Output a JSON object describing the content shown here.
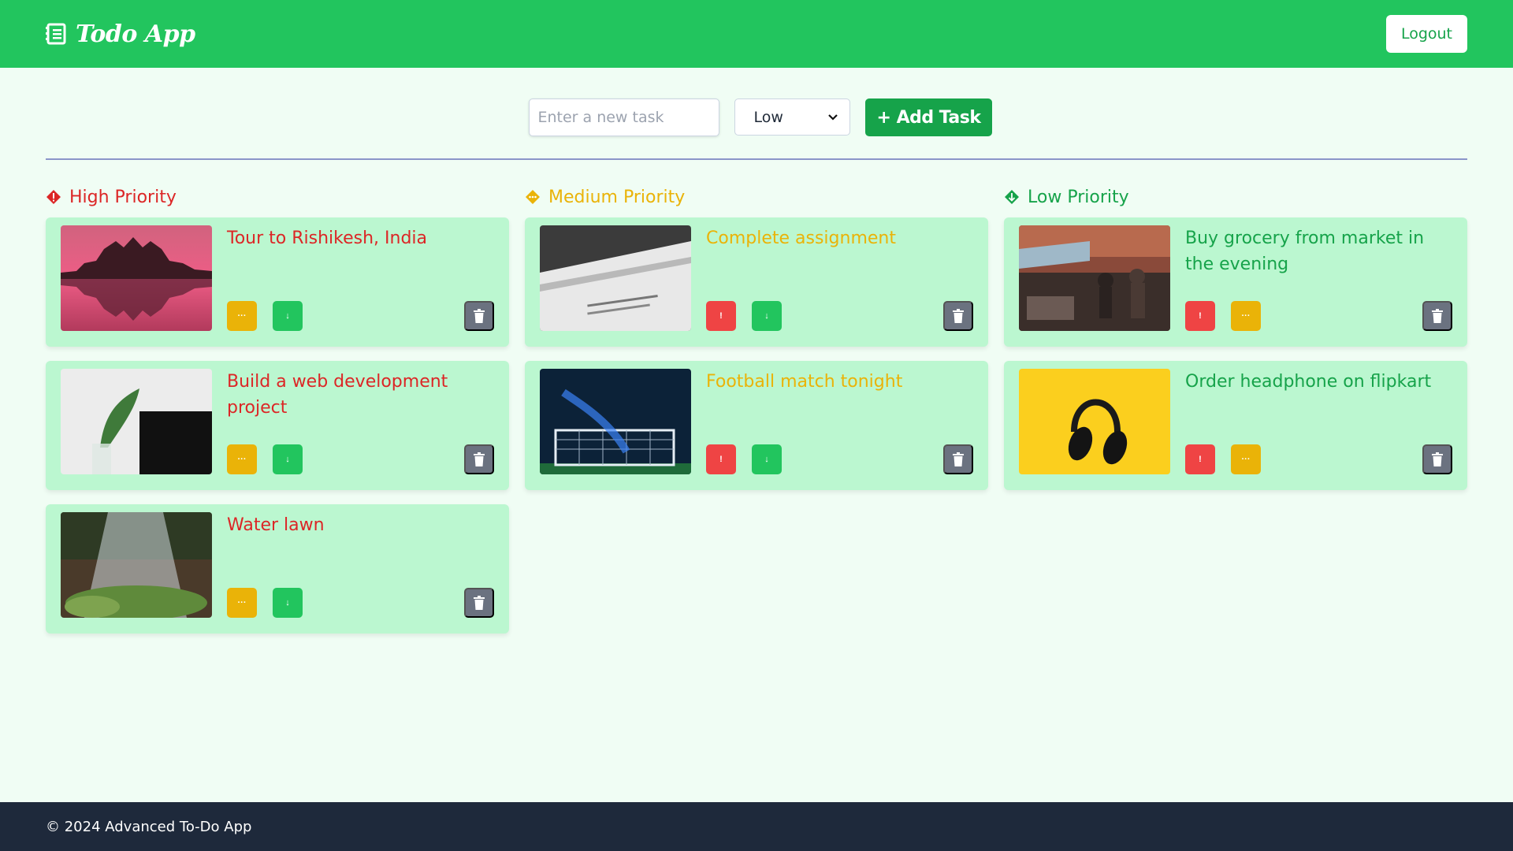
{
  "header": {
    "title": "Todo App",
    "logout_label": "Logout",
    "bg_color": "#22c55e"
  },
  "form": {
    "task_placeholder": "Enter a new task",
    "priority_selected": "Low",
    "add_label": "+ Add Task"
  },
  "columns": {
    "high": {
      "title": "High Priority",
      "color": "#dc2626",
      "tasks": [
        {
          "title": "Tour to Rishikesh, India",
          "image": "palace-at-sunset-reflection"
        },
        {
          "title": "Build a web development project",
          "image": "plant-and-laptop"
        },
        {
          "title": "Water lawn",
          "image": "sprinkling-water-on-plants"
        }
      ],
      "buttons": [
        {
          "symbol": "···",
          "color": "#eab308"
        },
        {
          "symbol": "↓",
          "color": "#22c55e"
        }
      ]
    },
    "medium": {
      "title": "Medium Priority",
      "color": "#eab308",
      "tasks": [
        {
          "title": "Complete assignment",
          "image": "stack-of-papers"
        },
        {
          "title": "Football match tonight",
          "image": "goalkeeper-diving-at-night"
        }
      ],
      "buttons": [
        {
          "symbol": "!",
          "color": "#ef4444"
        },
        {
          "symbol": "↓",
          "color": "#22c55e"
        }
      ]
    },
    "low": {
      "title": "Low Priority",
      "color": "#16a34a",
      "tasks": [
        {
          "title": "Buy grocery from market in the evening",
          "image": "street-market"
        },
        {
          "title": "Order headphone on flipkart",
          "image": "headphones-on-yellow"
        }
      ],
      "buttons": [
        {
          "symbol": "!",
          "color": "#ef4444"
        },
        {
          "symbol": "···",
          "color": "#eab308"
        }
      ]
    }
  },
  "icons": {
    "brand": "notebook-icon",
    "delete": "trash-icon",
    "high": "exclamation-diamond-icon",
    "medium": "dots-diamond-icon",
    "low": "down-arrow-diamond-icon"
  },
  "footer": {
    "text": "© 2024 Advanced To-Do App"
  }
}
